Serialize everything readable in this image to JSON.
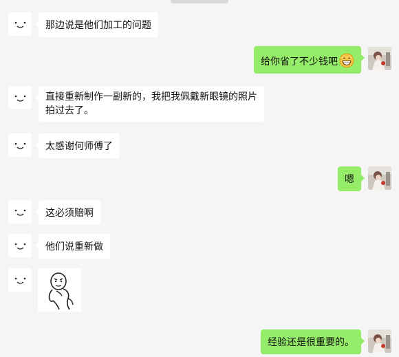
{
  "messages": [
    {
      "side": "left",
      "text": "那边说是他们加工的问题"
    },
    {
      "side": "right",
      "text": "给你省了不少钱吧",
      "emoji": "grinning-face-emoji"
    },
    {
      "side": "left",
      "text": "直接重新制作一副新的，我把我佩戴新眼镜的照片拍过去了。"
    },
    {
      "side": "left",
      "text": "太感谢何师傅了"
    },
    {
      "side": "right",
      "text": "嗯"
    },
    {
      "side": "left",
      "text": "这必须赔啊"
    },
    {
      "side": "left",
      "text": "他们说重新做"
    },
    {
      "side": "left",
      "type": "sticker",
      "sticker": "cartoon-bald-man-sticker"
    },
    {
      "side": "right",
      "text": "经验还是很重要的。"
    }
  ],
  "colors": {
    "background": "#f5f5f5",
    "incoming_bubble": "#ffffff",
    "outgoing_bubble": "#95ec69"
  },
  "icons": {
    "contact_avatar": "smiley-face-avatar",
    "self_avatar": "photo-avatar"
  }
}
